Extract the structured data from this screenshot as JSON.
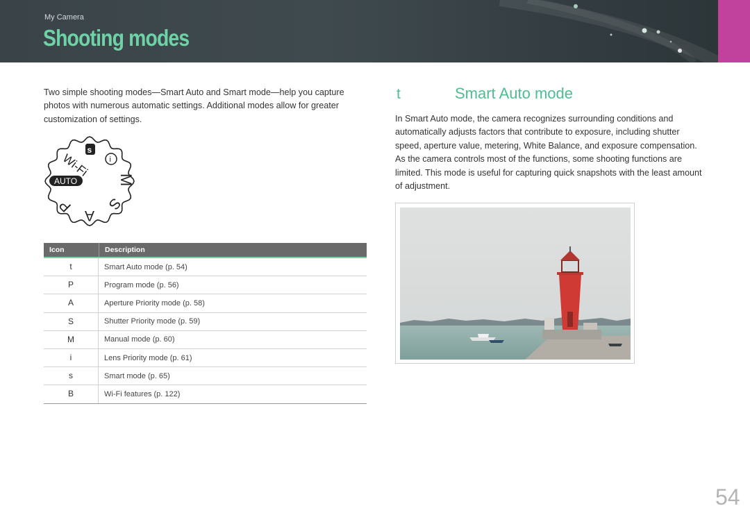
{
  "header": {
    "section": "My Camera",
    "title": "Shooting modes"
  },
  "intro": "Two simple shooting modes—Smart Auto and Smart mode—help you capture photos with numerous automatic settings. Additional modes allow for greater customization of settings.",
  "dial": {
    "labels": [
      "Wi-Fi",
      "s",
      "i",
      "M",
      "S",
      "A",
      "P",
      "AUTO"
    ]
  },
  "table": {
    "headers": {
      "icon": "Icon",
      "description": "Description"
    },
    "rows": [
      {
        "icon": "t",
        "description": "Smart Auto mode (p. 54)"
      },
      {
        "icon": "P",
        "description": "Program mode (p. 56)"
      },
      {
        "icon": "A",
        "description": "Aperture Priority mode (p. 58)"
      },
      {
        "icon": "S",
        "description": "Shutter Priority mode (p. 59)"
      },
      {
        "icon": "M",
        "description": "Manual mode (p. 60)"
      },
      {
        "icon": "i",
        "description": "Lens Priority mode (p. 61)"
      },
      {
        "icon": "s",
        "description": "Smart mode (p. 65)"
      },
      {
        "icon": "B",
        "description": "Wi-Fi features (p. 122)"
      }
    ]
  },
  "smart_auto": {
    "icon": "t",
    "title": "Smart Auto mode",
    "text": "In Smart Auto mode, the camera recognizes surrounding conditions and automatically adjusts factors that contribute to exposure, including shutter speed, aperture value, metering, White Balance, and exposure compensation. As the camera controls most of the functions, some shooting functions are limited. This mode is useful for capturing quick snapshots with the least amount of adjustment."
  },
  "page_number": "54",
  "colors": {
    "accent": "#4dbd92",
    "header_bg": "#3f4a4f",
    "tab": "#c1429c"
  }
}
